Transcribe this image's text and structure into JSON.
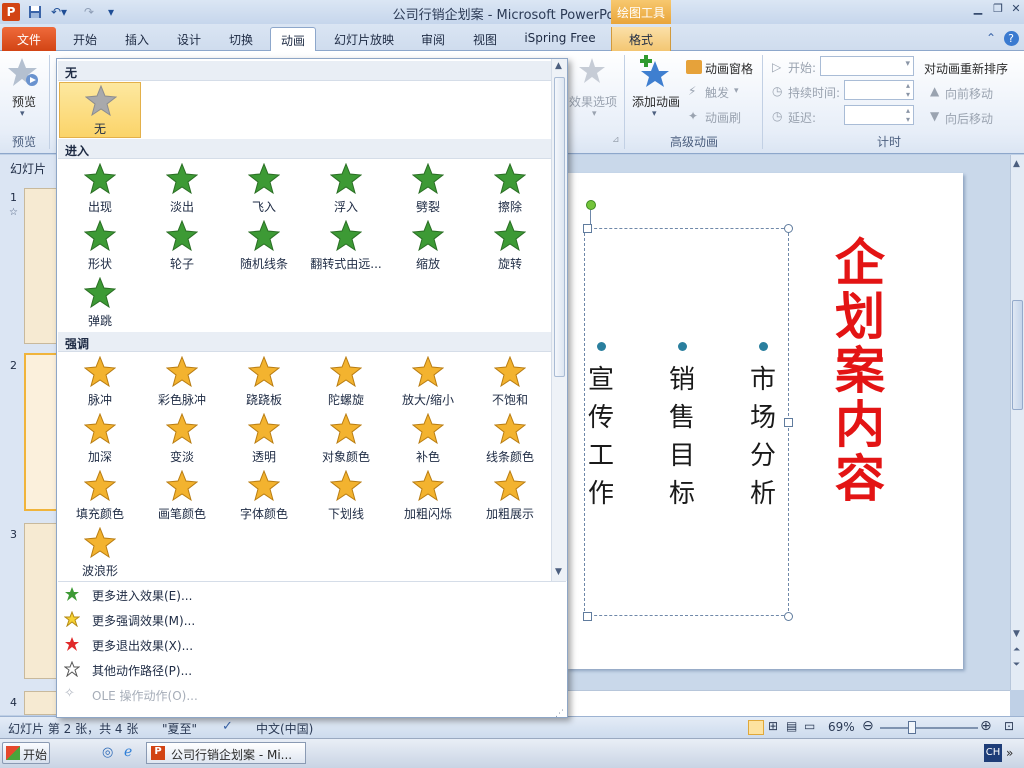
{
  "window": {
    "title": "公司行销企划案 - Microsoft PowerPoint",
    "context_group": "绘图工具"
  },
  "tabs": [
    {
      "label": "文件"
    },
    {
      "label": "开始"
    },
    {
      "label": "插入"
    },
    {
      "label": "设计"
    },
    {
      "label": "切换"
    },
    {
      "label": "动画"
    },
    {
      "label": "幻灯片放映"
    },
    {
      "label": "审阅"
    },
    {
      "label": "视图"
    },
    {
      "label": "iSpring Free"
    },
    {
      "label": "格式"
    }
  ],
  "ribbon": {
    "preview_label": "预览",
    "preview_group": "预览",
    "effect_options": "效果选项",
    "add_animation": "添加动画",
    "animation_pane": "动画窗格",
    "trigger": "触发",
    "animation_painter": "动画刷",
    "advanced_group": "高级动画",
    "start_label": "开始:",
    "duration_label": "持续时间:",
    "delay_label": "延迟:",
    "timing_group": "计时",
    "reorder_title": "对动画重新排序",
    "move_earlier": "向前移动",
    "move_later": "向后移动"
  },
  "gallery": {
    "none_header": "无",
    "none_item": "无",
    "entrance_header": "进入",
    "entrance": [
      "出现",
      "淡出",
      "飞入",
      "浮入",
      "劈裂",
      "擦除",
      "形状",
      "轮子",
      "随机线条",
      "翻转式由远...",
      "缩放",
      "旋转",
      "弹跳"
    ],
    "emphasis_header": "强调",
    "emphasis": [
      "脉冲",
      "彩色脉冲",
      "跷跷板",
      "陀螺旋",
      "放大/缩小",
      "不饱和",
      "加深",
      "变淡",
      "透明",
      "对象颜色",
      "补色",
      "线条颜色",
      "填充颜色",
      "画笔颜色",
      "字体颜色",
      "下划线",
      "加粗闪烁",
      "加粗展示",
      "波浪形"
    ],
    "more": [
      {
        "label": "更多进入效果(E)..."
      },
      {
        "label": "更多强调效果(M)..."
      },
      {
        "label": "更多退出效果(X)..."
      },
      {
        "label": "其他动作路径(P)..."
      },
      {
        "label": "OLE 操作动作(O)..."
      }
    ]
  },
  "slides_panel": {
    "header": "幻灯片",
    "numbers": [
      "1",
      "2",
      "3",
      "4"
    ]
  },
  "slide": {
    "columns": [
      {
        "text": "宣\n传\n工\n作"
      },
      {
        "text": "销\n售\n目\n标"
      },
      {
        "text": "市\n场\n分\n析"
      }
    ],
    "title": "企\n划\n案\n内\n容"
  },
  "status": {
    "slide_info": "幻灯片 第 2 张，共 4 张",
    "theme": "\"夏至\"",
    "language": "中文(中国)",
    "zoom": "69%"
  },
  "taskbar": {
    "start": "开始",
    "window_item": "公司行销企划案 - Mi...",
    "ime": "CH"
  },
  "colors": {
    "title_red": "#e31414",
    "file_tab": "#d24414",
    "context_tab": "#f3c672",
    "star_green": "#3d9a35",
    "star_gold": "#f3b32f"
  }
}
